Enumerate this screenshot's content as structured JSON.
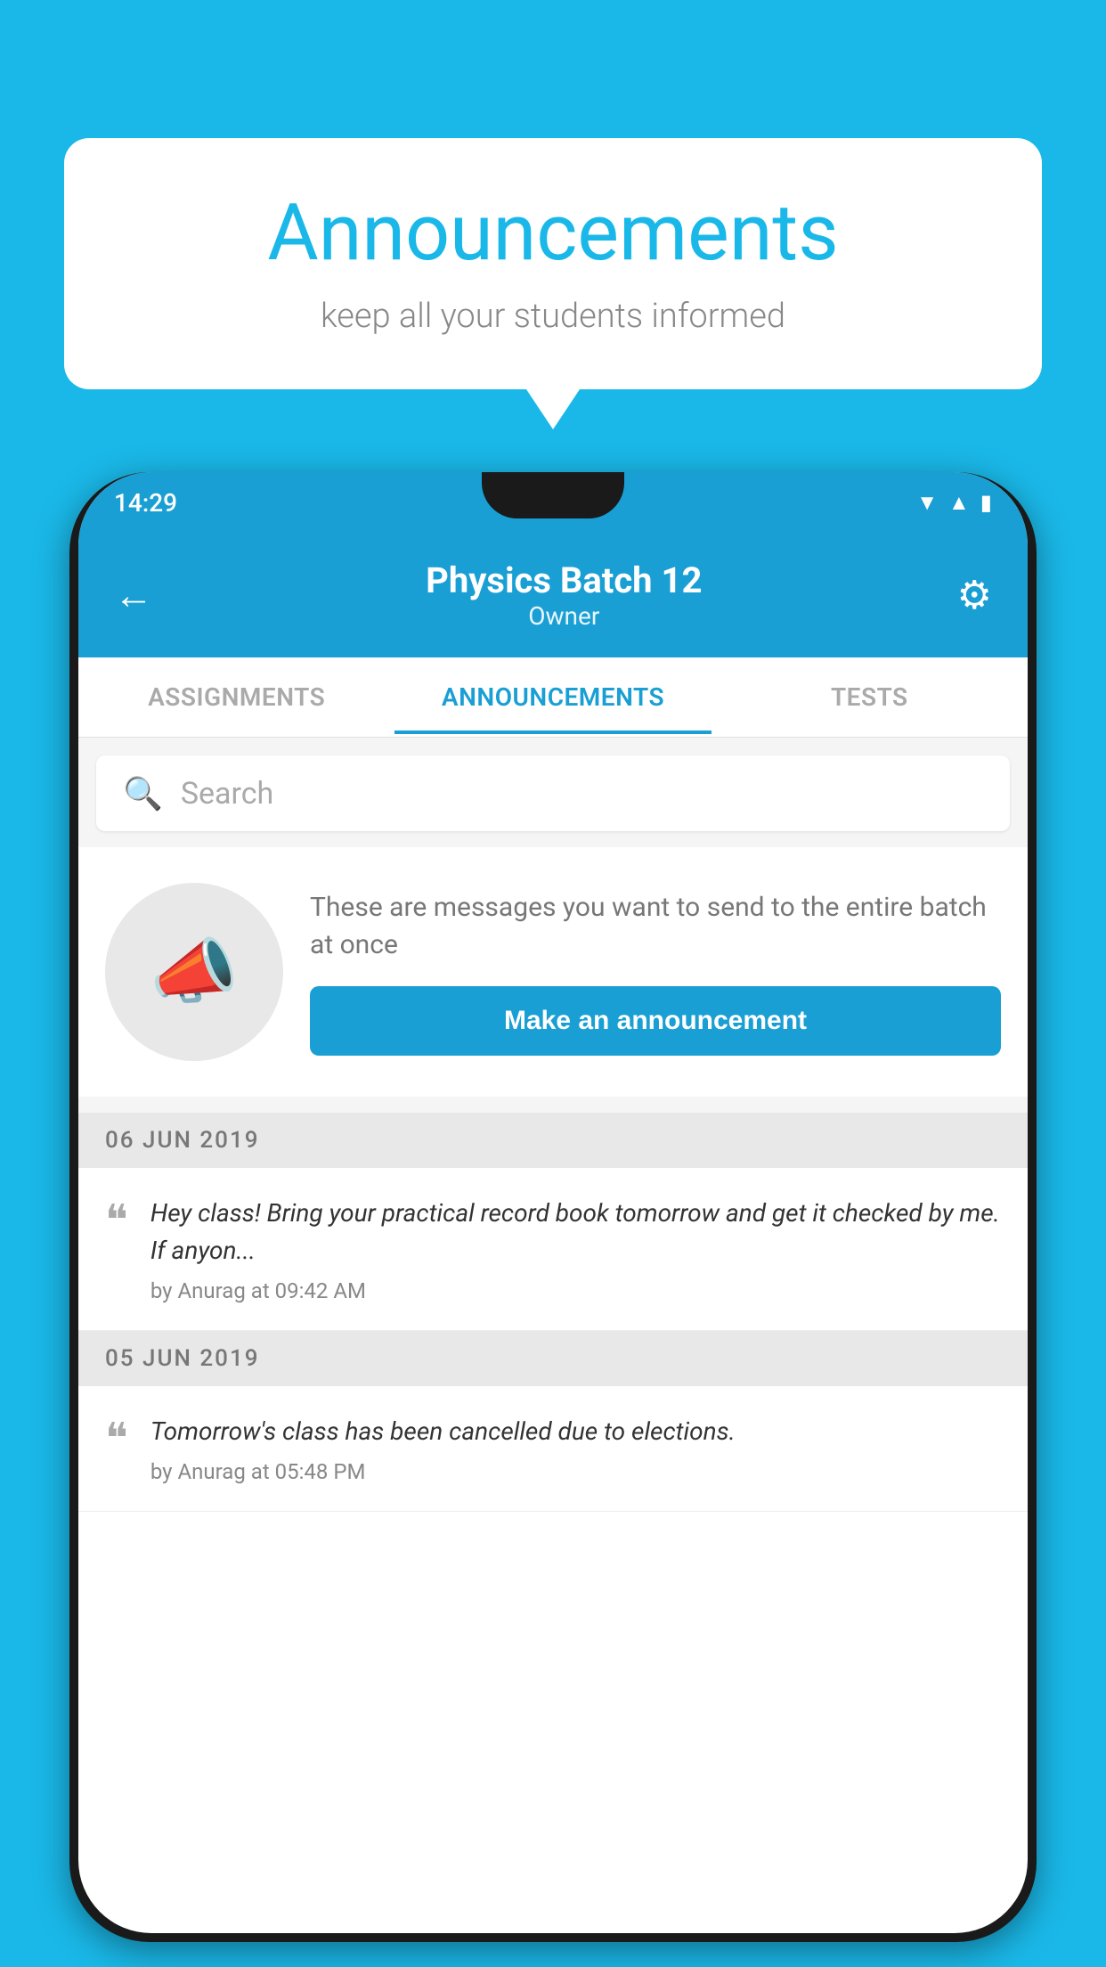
{
  "background_color": "#1ab8e8",
  "speech_bubble": {
    "title": "Announcements",
    "subtitle": "keep all your students informed"
  },
  "phone": {
    "status_bar": {
      "time": "14:29",
      "icons": [
        "wifi",
        "signal",
        "battery"
      ]
    },
    "header": {
      "title": "Physics Batch 12",
      "subtitle": "Owner",
      "back_label": "←",
      "gear_label": "⚙"
    },
    "tabs": [
      {
        "label": "ASSIGNMENTS",
        "active": false
      },
      {
        "label": "ANNOUNCEMENTS",
        "active": true
      },
      {
        "label": "TESTS",
        "active": false
      }
    ],
    "search": {
      "placeholder": "Search"
    },
    "promo": {
      "description_text": "These are messages you want to send to the entire batch at once",
      "button_label": "Make an announcement"
    },
    "announcements": [
      {
        "date": "06  JUN  2019",
        "text": "Hey class! Bring your practical record book tomorrow and get it checked by me. If anyon...",
        "meta": "by Anurag at 09:42 AM"
      },
      {
        "date": "05  JUN  2019",
        "text": "Tomorrow's class has been cancelled due to elections.",
        "meta": "by Anurag at 05:48 PM"
      }
    ]
  }
}
